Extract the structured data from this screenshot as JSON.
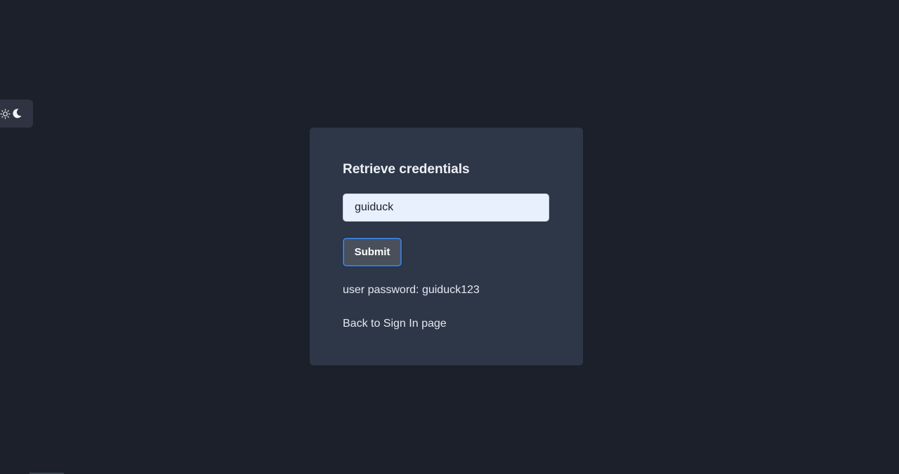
{
  "theme_toggle": {
    "sun_icon": "sun-icon",
    "moon_icon": "moon-icon"
  },
  "card": {
    "title": "Retrieve credentials",
    "username_value": "guiduck",
    "submit_label": "Submit",
    "result_text": "user password: guiduck123",
    "back_link_label": "Back to Sign In page"
  },
  "colors": {
    "background": "#1c202b",
    "card": "#2e3748",
    "input_bg": "#e8f0fe",
    "button_bg": "#49505c",
    "button_focus_border": "#3b7bd0"
  }
}
